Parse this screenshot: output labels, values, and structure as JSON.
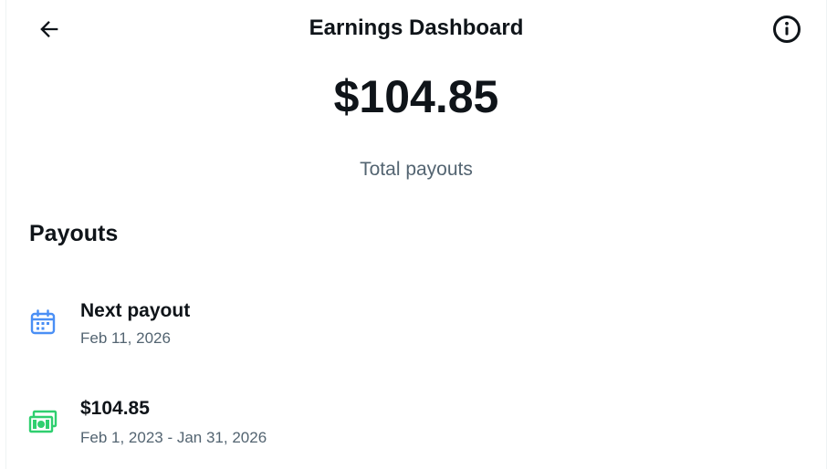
{
  "header": {
    "title": "Earnings Dashboard",
    "back_icon": "back-arrow-icon",
    "info_icon": "info-icon"
  },
  "summary": {
    "total_amount": "$104.85",
    "total_label": "Total payouts"
  },
  "payouts": {
    "heading": "Payouts",
    "items": [
      {
        "icon": "calendar-icon",
        "title": "Next payout",
        "subtitle": "Feb 11, 2026",
        "icon_color": "#4a8ff5"
      },
      {
        "icon": "cash-icon",
        "title": "$104.85",
        "subtitle": "Feb 1, 2023 - Jan 31, 2026",
        "icon_color": "#2fcf6f"
      }
    ]
  },
  "colors": {
    "text_primary": "#0f1419",
    "text_secondary": "#536471",
    "border": "#eff3f4"
  }
}
